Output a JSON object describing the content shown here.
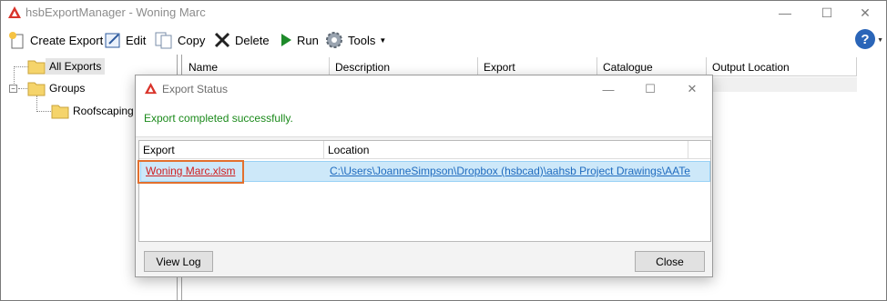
{
  "window": {
    "title": "hsbExportManager - Woning Marc"
  },
  "toolbar": {
    "create_export": "Create Export",
    "edit": "Edit",
    "copy": "Copy",
    "delete": "Delete",
    "run": "Run",
    "tools": "Tools",
    "help": "?"
  },
  "tree": {
    "items": [
      {
        "label": "All Exports"
      },
      {
        "label": "Groups"
      },
      {
        "label": "Roofscaping"
      }
    ]
  },
  "grid": {
    "columns": [
      "Name",
      "Description",
      "Export",
      "Catalogue",
      "Output Location"
    ]
  },
  "dialog": {
    "title": "Export Status",
    "message": "Export completed successfully.",
    "columns": [
      "Export",
      "Location"
    ],
    "rows": [
      {
        "export": "Woning Marc.xlsm",
        "location": "C:\\Users\\JoanneSimpson\\Dropbox (hsbcad)\\aahsb Project Drawings\\AATe"
      }
    ],
    "view_log": "View Log",
    "close": "Close"
  },
  "colors": {
    "success_text": "#1b8a1b",
    "link_export": "#d02020",
    "link_location": "#1f6bbf",
    "highlight_box": "#e2702e",
    "selected_row": "#cde8f9"
  }
}
